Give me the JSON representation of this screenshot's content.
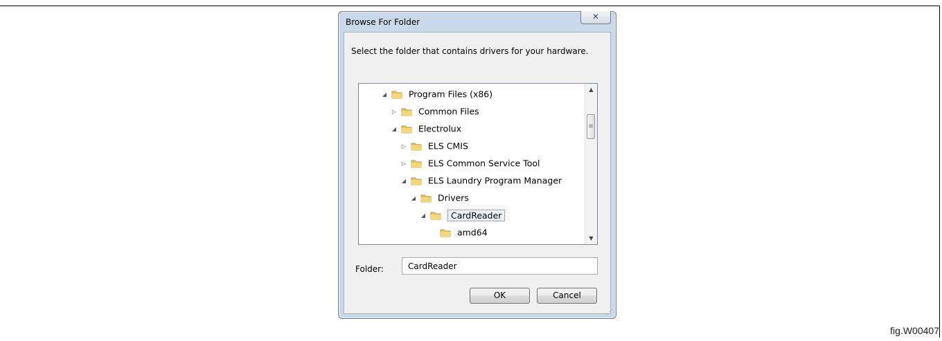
{
  "figure_label": "fig.W00407",
  "dialog": {
    "title": "Browse For Folder",
    "close_glyph": "✕",
    "instruction": "Select the folder that contains drivers for your hardware.",
    "tree": [
      {
        "label": "Program Files (x86)",
        "expanded": true,
        "depth": 0
      },
      {
        "label": "Common Files",
        "expanded": false,
        "depth": 1
      },
      {
        "label": "Electrolux",
        "expanded": true,
        "depth": 1
      },
      {
        "label": "ELS CMIS",
        "expanded": false,
        "depth": 2
      },
      {
        "label": "ELS Common Service Tool",
        "expanded": false,
        "depth": 2
      },
      {
        "label": "ELS Laundry Program Manager",
        "expanded": true,
        "depth": 2
      },
      {
        "label": "Drivers",
        "expanded": true,
        "depth": 3
      },
      {
        "label": "CardReader",
        "expanded": true,
        "depth": 4,
        "selected": true
      },
      {
        "label": "amd64",
        "expanded": null,
        "depth": 5
      }
    ],
    "folder_label": "Folder:",
    "folder_value": "CardReader",
    "ok_label": "OK",
    "cancel_label": "Cancel"
  },
  "icons": {
    "expanded": "◢",
    "collapsed": "▷",
    "scroll_up": "▲",
    "scroll_down": "▼",
    "thumb_grip": "≡",
    "resize_grip": "⋰"
  },
  "colors": {
    "folder_body": "#e8c25a",
    "folder_tab": "#d6a93a",
    "dialog_frame": "#c9d9ea"
  }
}
